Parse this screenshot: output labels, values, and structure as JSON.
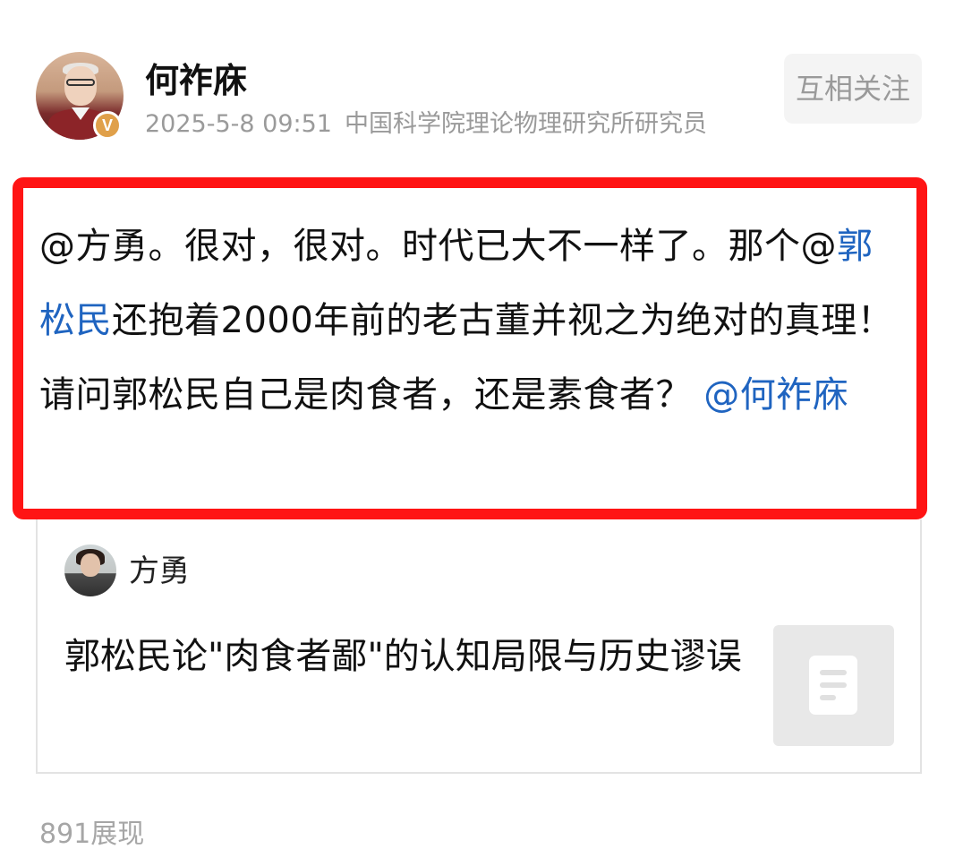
{
  "header": {
    "author_name": "何祚庥",
    "time": "2025-5-8 09:51",
    "author_title": "中国科学院理论物理研究所研究员",
    "verified_badge": "V",
    "follow_label": "互相关注"
  },
  "post": {
    "seg1": "@方勇。很对，很对。时代已大不一样了。那个@",
    "mention1": "郭松民",
    "seg2": "还抱着2000年前的老古董并视之为绝对的真理！请问郭松民自己是肉食者，还是素食者？",
    "mention2": "@何祚庥"
  },
  "quote": {
    "author": "方勇",
    "title": "郭松民论\"肉食者鄙\"的认知局限与历史谬误"
  },
  "footer": {
    "views": "891展现"
  },
  "colors": {
    "highlight_border": "#ff1414",
    "mention": "#1f64c0",
    "meta_gray": "#9a9a9a",
    "badge": "#e0a04a"
  },
  "icons": {
    "thumb": "document-icon",
    "badge": "verified-badge-icon"
  }
}
